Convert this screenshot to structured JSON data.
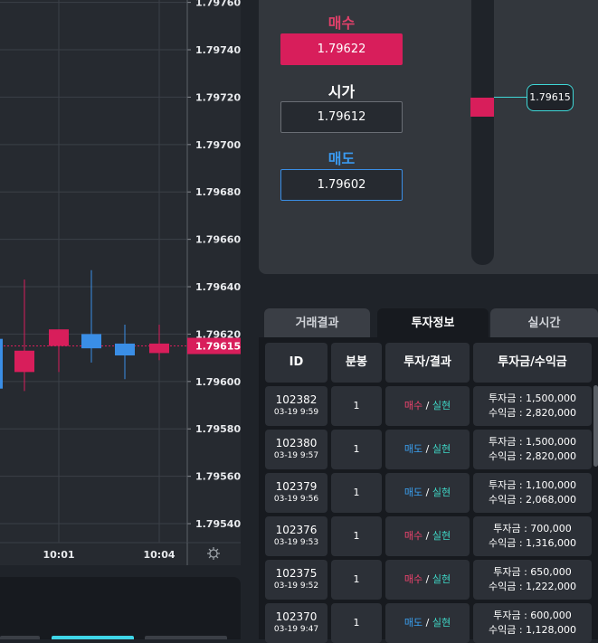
{
  "chart": {
    "y_axis_labels": [
      "1.79760",
      "1.79740",
      "1.79720",
      "1.79700",
      "1.79680",
      "1.79660",
      "1.79640",
      "1.79620",
      "1.79600",
      "1.79580",
      "1.79560",
      "1.79540"
    ],
    "current_price_tag": "1.79615",
    "x_axis_labels": [
      "10:01",
      "10:04"
    ],
    "settings_icon": "gear-icon"
  },
  "chart_data": {
    "type": "candlestick",
    "y_range": [
      1.79532,
      1.79761
    ],
    "current_price": 1.79615,
    "candles": [
      {
        "open": 1.79618,
        "high": 1.79618,
        "low": 1.79597,
        "close": 1.79597,
        "color": "#3a8ee6"
      },
      {
        "open": 1.79613,
        "high": 1.79643,
        "low": 1.79596,
        "close": 1.79604,
        "color": "#d81e5b"
      },
      {
        "open": 1.79622,
        "high": 1.79622,
        "low": 1.79604,
        "close": 1.79615,
        "color": "#d81e5b"
      },
      {
        "open": 1.7962,
        "high": 1.79647,
        "low": 1.79608,
        "close": 1.79614,
        "color": "#3a8ee6"
      },
      {
        "open": 1.79616,
        "high": 1.79624,
        "low": 1.79601,
        "close": 1.79611,
        "color": "#3a8ee6"
      },
      {
        "open": 1.79616,
        "high": 1.79624,
        "low": 1.79609,
        "close": 1.79612,
        "color": "#d81e5b"
      }
    ]
  },
  "trade": {
    "buy_label": "매수",
    "buy_price": "1.79622",
    "market_label": "시가",
    "market_price": "1.79612",
    "sell_label": "매도",
    "sell_price": "1.79602",
    "slider_tag": "1.79615"
  },
  "tabs": [
    "거래결과",
    "투자정보",
    "실시간"
  ],
  "table": {
    "headers": [
      "ID",
      "분봉",
      "투자/결과",
      "투자금/수익금"
    ],
    "rows": [
      {
        "id": "102382",
        "time": "03-19 9:59",
        "minutes": "1",
        "direction": "매수",
        "result": "실현",
        "invest": "투자금 : 1,500,000",
        "profit": "수익금 : 2,820,000"
      },
      {
        "id": "102380",
        "time": "03-19 9:57",
        "minutes": "1",
        "direction": "매도",
        "result": "실현",
        "invest": "투자금 : 1,500,000",
        "profit": "수익금 : 2,820,000"
      },
      {
        "id": "102379",
        "time": "03-19 9:56",
        "minutes": "1",
        "direction": "매도",
        "result": "실현",
        "invest": "투자금 : 1,100,000",
        "profit": "수익금 : 2,068,000"
      },
      {
        "id": "102376",
        "time": "03-19 9:53",
        "minutes": "1",
        "direction": "매수",
        "result": "실현",
        "invest": "투자금 : 700,000",
        "profit": "수익금 : 1,316,000"
      },
      {
        "id": "102375",
        "time": "03-19 9:52",
        "minutes": "1",
        "direction": "매수",
        "result": "실현",
        "invest": "투자금 : 650,000",
        "profit": "수익금 : 1,222,000"
      },
      {
        "id": "102370",
        "time": "03-19 9:47",
        "minutes": "1",
        "direction": "매도",
        "result": "실현",
        "invest": "투자금 : 600,000",
        "profit": "수익금 : 1,128,000"
      }
    ]
  },
  "colors": {
    "buy": "#d81e5b",
    "sell": "#3a8ee6",
    "accent": "#3fd6d6"
  }
}
